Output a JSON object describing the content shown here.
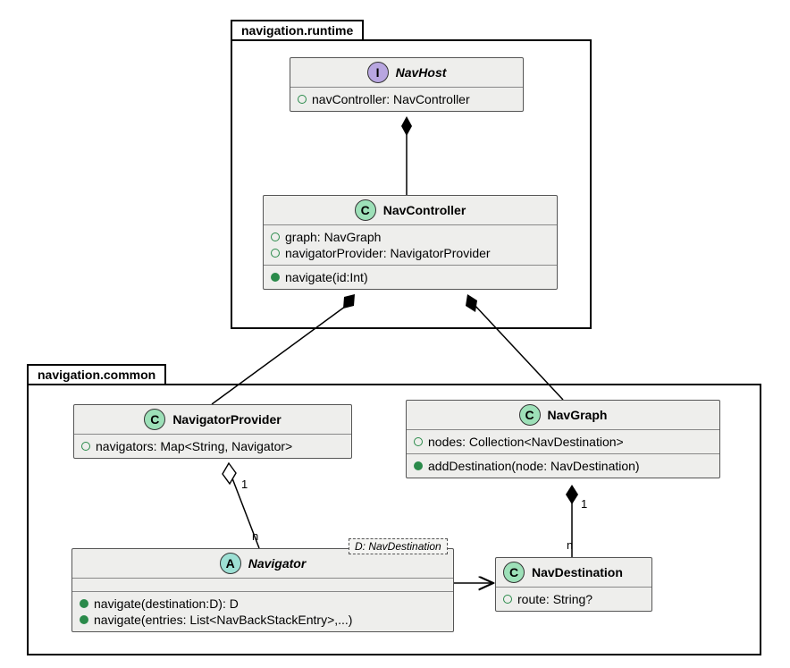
{
  "packages": {
    "runtime": {
      "label": "navigation.runtime"
    },
    "common": {
      "label": "navigation.common"
    }
  },
  "classes": {
    "navhost": {
      "stereotype_letter": "I",
      "name": "NavHost",
      "props": [
        {
          "dot": "open",
          "text": "navController: NavController"
        }
      ]
    },
    "navcontroller": {
      "stereotype_letter": "C",
      "name": "NavController",
      "props": [
        {
          "dot": "open",
          "text": "graph: NavGraph"
        },
        {
          "dot": "open",
          "text": "navigatorProvider: NavigatorProvider"
        }
      ],
      "methods": [
        {
          "dot": "filled",
          "text": "navigate(id:Int)"
        }
      ]
    },
    "navigatorprovider": {
      "stereotype_letter": "C",
      "name": "NavigatorProvider",
      "props": [
        {
          "dot": "open",
          "text": "navigators: Map<String, Navigator>"
        }
      ]
    },
    "navgraph": {
      "stereotype_letter": "C",
      "name": "NavGraph",
      "props": [
        {
          "dot": "open",
          "text": "nodes: Collection<NavDestination>"
        }
      ],
      "methods": [
        {
          "dot": "filled",
          "text": "addDestination(node: NavDestination)"
        }
      ]
    },
    "navigator": {
      "stereotype_letter": "A",
      "name": "Navigator",
      "template_param": "D: NavDestination",
      "methods": [
        {
          "dot": "filled",
          "text": "navigate(destination:D): D"
        },
        {
          "dot": "filled",
          "text": "navigate(entries: List<NavBackStackEntry>,...)"
        }
      ]
    },
    "navdestination": {
      "stereotype_letter": "C",
      "name": "NavDestination",
      "props": [
        {
          "dot": "open",
          "text": "route: String?"
        }
      ]
    }
  },
  "relations": {
    "navhost_navcontroller": {
      "kind": "composition"
    },
    "navcontroller_navgraph": {
      "kind": "composition"
    },
    "navcontroller_navigatorprov": {
      "kind": "composition"
    },
    "navigator_navdestination": {
      "kind": "association_arrow"
    },
    "navigatorprov_navigator": {
      "kind": "aggregation",
      "whole_mult": "1",
      "part_mult": "n"
    },
    "navgraph_navdestination": {
      "kind": "composition",
      "whole_mult": "1",
      "part_mult": "n"
    }
  },
  "chart_data": {
    "type": "uml-class-diagram",
    "packages": [
      {
        "name": "navigation.runtime",
        "classes": [
          {
            "name": "NavHost",
            "kind": "interface",
            "properties": [
              "navController: NavController"
            ],
            "methods": []
          },
          {
            "name": "NavController",
            "kind": "class",
            "properties": [
              "graph: NavGraph",
              "navigatorProvider: NavigatorProvider"
            ],
            "methods": [
              "navigate(id:Int)"
            ]
          }
        ]
      },
      {
        "name": "navigation.common",
        "classes": [
          {
            "name": "NavigatorProvider",
            "kind": "class",
            "properties": [
              "navigators: Map<String, Navigator>"
            ],
            "methods": []
          },
          {
            "name": "NavGraph",
            "kind": "class",
            "properties": [
              "nodes: Collection<NavDestination>"
            ],
            "methods": [
              "addDestination(node: NavDestination)"
            ]
          },
          {
            "name": "Navigator",
            "kind": "abstract",
            "template": "D: NavDestination",
            "properties": [],
            "methods": [
              "navigate(destination:D): D",
              "navigate(entries: List<NavBackStackEntry>,...)"
            ]
          },
          {
            "name": "NavDestination",
            "kind": "class",
            "properties": [
              "route: String?"
            ],
            "methods": []
          }
        ]
      }
    ],
    "relations": [
      {
        "from": "NavHost",
        "to": "NavController",
        "type": "composition"
      },
      {
        "from": "NavController",
        "to": "NavGraph",
        "type": "composition"
      },
      {
        "from": "NavController",
        "to": "NavigatorProvider",
        "type": "composition"
      },
      {
        "from": "NavigatorProvider",
        "to": "Navigator",
        "type": "aggregation",
        "from_mult": "1",
        "to_mult": "n"
      },
      {
        "from": "NavGraph",
        "to": "NavDestination",
        "type": "composition",
        "from_mult": "1",
        "to_mult": "n"
      },
      {
        "from": "Navigator",
        "to": "NavDestination",
        "type": "association"
      }
    ]
  }
}
